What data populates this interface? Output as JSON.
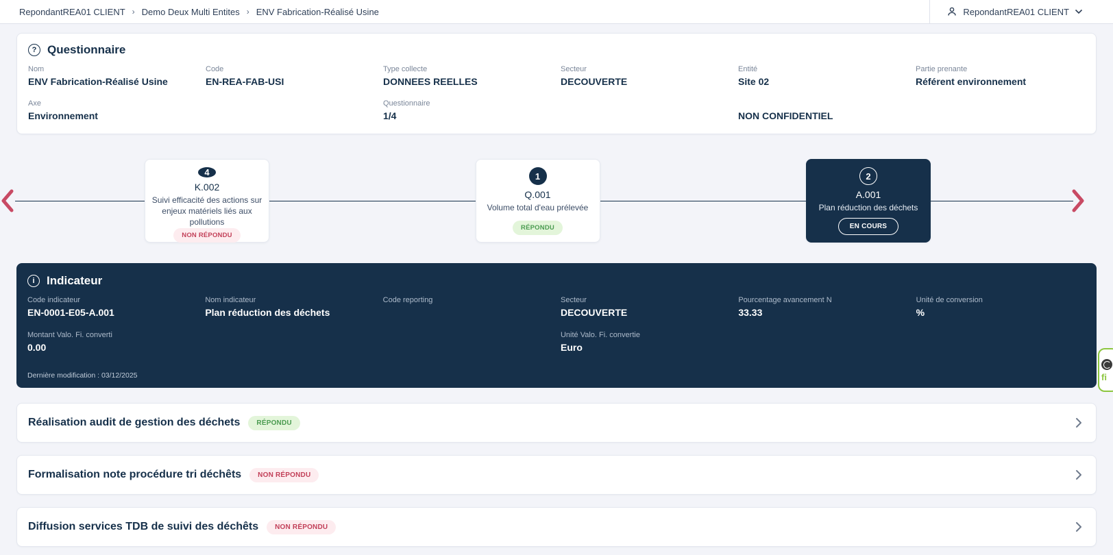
{
  "colors": {
    "navy": "#16304a",
    "page_bg": "#f3f4f9",
    "status_red_text": "#c23f58",
    "status_red_bg": "#fdecef",
    "status_green_text": "#4a9b50",
    "status_green_bg": "#e3f5da",
    "arrow_pink": "#c84a64",
    "widget_green": "#8cc63f"
  },
  "topbar": {
    "breadcrumb": [
      {
        "label": "RepondantREA01 CLIENT"
      },
      {
        "label": "Demo Deux Multi Entites"
      },
      {
        "label": "ENV Fabrication-Réalisé Usine"
      }
    ],
    "separator": "›",
    "user": {
      "name": "RepondantREA01 CLIENT",
      "icons": [
        "person-icon",
        "chevron-down-icon"
      ]
    }
  },
  "questionnaire": {
    "title": "Questionnaire",
    "icon": "question-circle-icon",
    "fields": [
      {
        "label": "Nom",
        "value": "ENV Fabrication-Réalisé Usine"
      },
      {
        "label": "Code",
        "value": "EN-REA-FAB-USI"
      },
      {
        "label": "Type collecte",
        "value": "DONNEES REELLES"
      },
      {
        "label": "Secteur",
        "value": "DECOUVERTE"
      },
      {
        "label": "Entité",
        "value": "Site 02"
      },
      {
        "label": "Partie prenante",
        "value": "Référent environnement"
      },
      {
        "label": "Axe",
        "value": "Environnement"
      },
      {
        "label": "Questionnaire",
        "value": "1/4"
      },
      {
        "label": "",
        "value": "NON CONFIDENTIEL"
      }
    ]
  },
  "carousel": {
    "left_arrow": "chevron-left-icon",
    "right_arrow": "chevron-right-icon",
    "cards": [
      {
        "badge": "4",
        "code": "K.002",
        "description": "Suivi efficacité des actions sur enjeux matériels liés aux pollutions",
        "status": "NON RÉPONDU"
      },
      {
        "badge": "1",
        "code": "Q.001",
        "description": "Volume total d'eau prélevée",
        "status": "RÉPONDU"
      },
      {
        "badge": "2",
        "code": "A.001",
        "description": "Plan réduction des déchets",
        "status": "EN COURS"
      }
    ]
  },
  "indicator": {
    "title": "Indicateur",
    "icon": "info-circle-icon",
    "fields": [
      {
        "label": "Code indicateur",
        "value": "EN-0001-E05-A.001"
      },
      {
        "label": "Nom indicateur",
        "value": "Plan réduction des déchets"
      },
      {
        "label": "Code reporting",
        "value": ""
      },
      {
        "label": "Secteur",
        "value": "DECOUVERTE"
      },
      {
        "label": "Pourcentage avancement N",
        "value": "33.33"
      },
      {
        "label": "Unité de conversion",
        "value": "%"
      },
      {
        "label": "Montant Valo. Fi. converti",
        "value": "0.00"
      },
      {
        "label": "Unité Valo. Fi. convertie",
        "value": "Euro"
      }
    ],
    "last_modified": "Dernière modification : 03/12/2025"
  },
  "questions": [
    {
      "title": "Réalisation audit de gestion des déchets",
      "status": "RÉPONDU"
    },
    {
      "title": "Formalisation note procédure tri déchêts",
      "status": "NON RÉPONDU"
    },
    {
      "title": "Diffusion services TDB de suivi des déchêts",
      "status": "NON RÉPONDU"
    }
  ]
}
